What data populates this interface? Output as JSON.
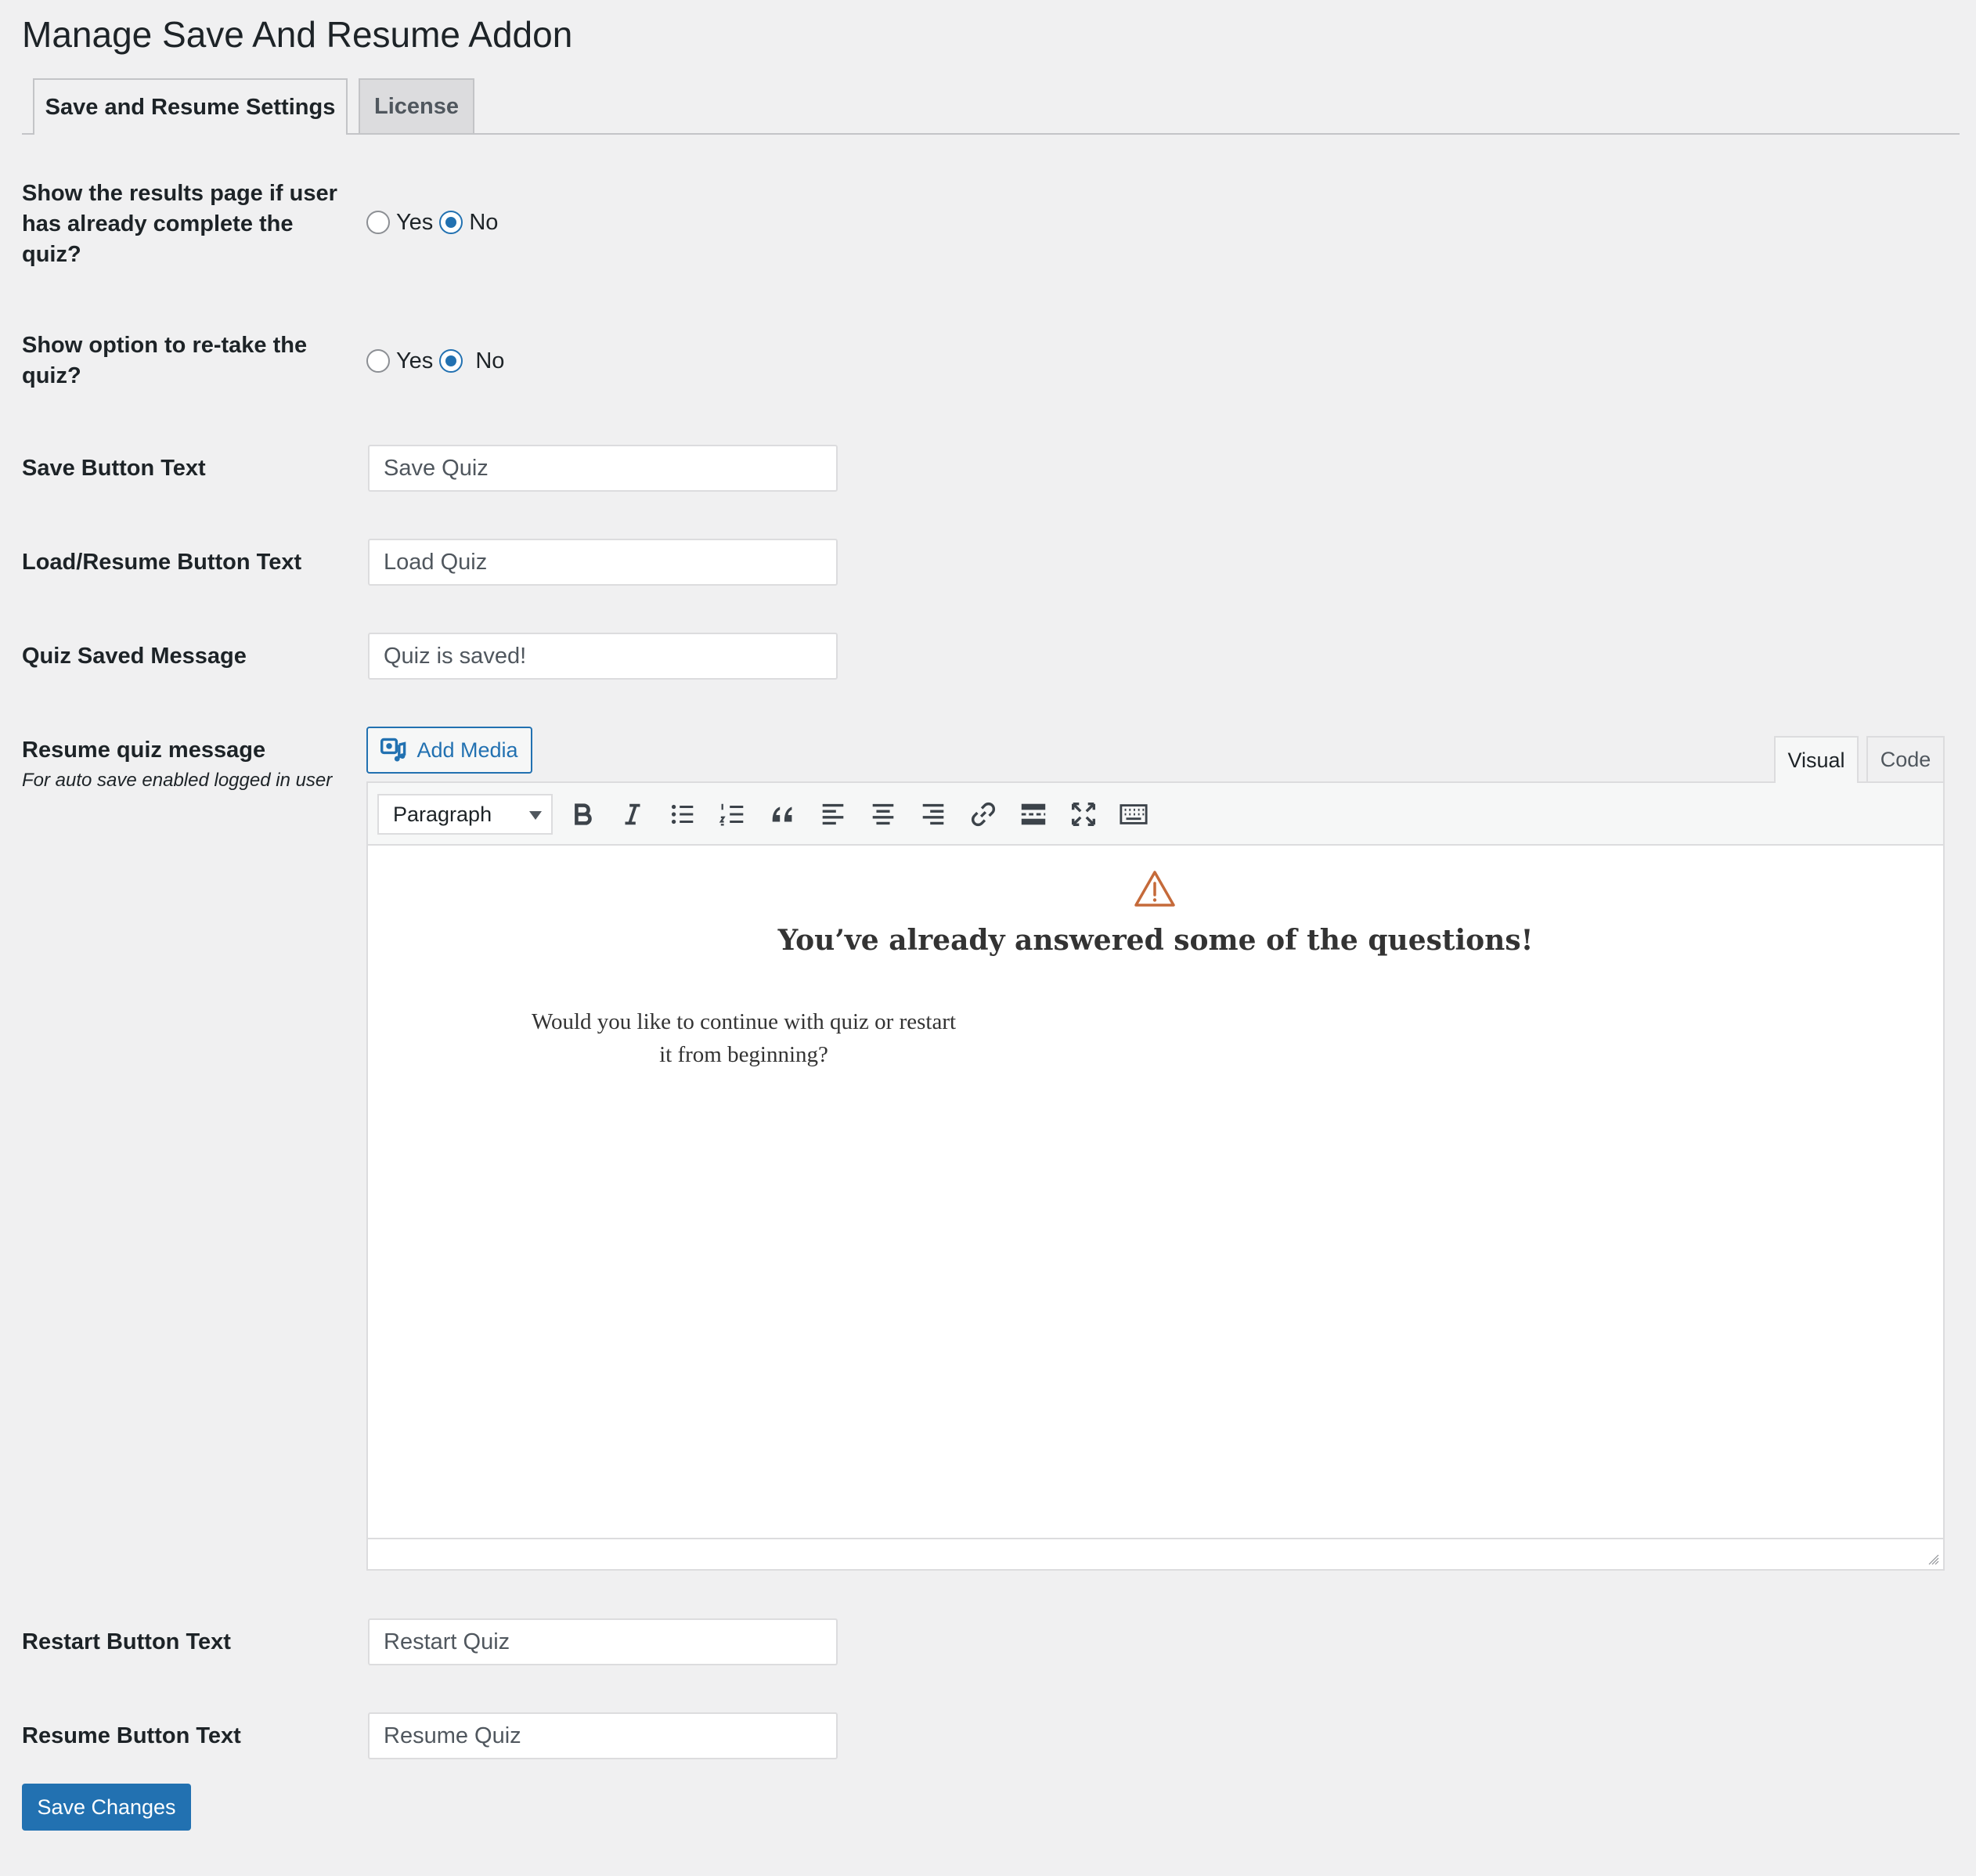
{
  "page": {
    "title": "Manage Save And Resume Addon"
  },
  "tabs": [
    {
      "label": "Save and Resume Settings",
      "active": true
    },
    {
      "label": "License",
      "active": false
    }
  ],
  "settings": {
    "show_results": {
      "label": "Show the results page if user has already complete the quiz?",
      "options": [
        "Yes",
        "No"
      ],
      "selected": "No"
    },
    "retake": {
      "label": "Show option to re-take the quiz?",
      "options": [
        "Yes",
        "No"
      ],
      "selected": "No"
    },
    "save_button": {
      "label": "Save Button Text",
      "value": "Save Quiz"
    },
    "load_button": {
      "label": "Load/Resume Button Text",
      "value": "Load Quiz"
    },
    "saved_message": {
      "label": "Quiz Saved Message",
      "value": "Quiz is saved!"
    },
    "resume_message": {
      "label": "Resume quiz message",
      "sublabel": "For auto save enabled logged in user"
    },
    "restart_button": {
      "label": "Restart Button Text",
      "value": "Restart Quiz"
    },
    "resume_button": {
      "label": "Resume Button Text",
      "value": "Resume Quiz"
    }
  },
  "editor": {
    "add_media_label": "Add Media",
    "mode_visual": "Visual",
    "mode_code": "Code",
    "format_selected": "Paragraph",
    "toolbar_icons": [
      "bold-icon",
      "italic-icon",
      "bullet-list-icon",
      "numbered-list-icon",
      "blockquote-icon",
      "align-left-icon",
      "align-center-icon",
      "align-right-icon",
      "link-icon",
      "read-more-icon",
      "fullscreen-icon",
      "toolbar-toggle-icon"
    ],
    "content": {
      "heading": "You’ve already answered some of the questions!",
      "paragraph_line1": "Would you like to continue with quiz or restart",
      "paragraph_line2": "it from beginning?"
    }
  },
  "actions": {
    "save_changes_label": "Save Changes"
  },
  "colors": {
    "accent": "#2271b1",
    "warning": "#c56a3a",
    "background": "#f0f0f1"
  }
}
